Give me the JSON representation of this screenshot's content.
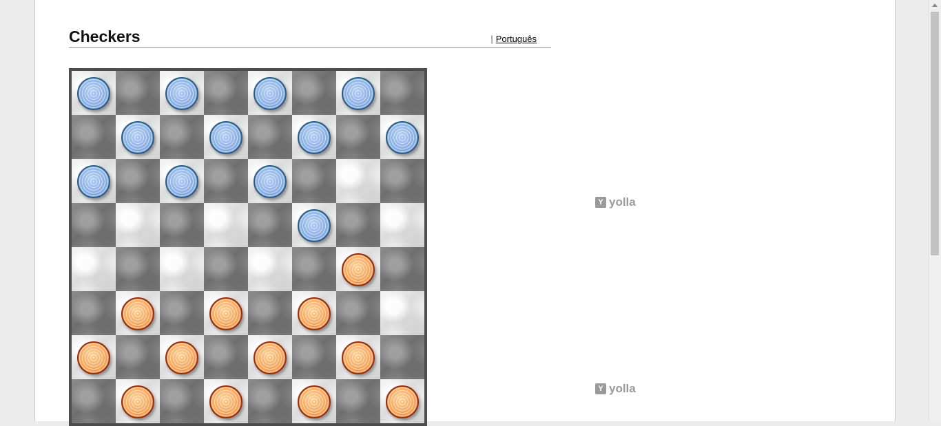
{
  "header": {
    "title": "Checkers",
    "lang_separator": "|",
    "lang_link": "Português"
  },
  "board": {
    "size": 8,
    "colors": {
      "light": "#e6e6e6",
      "dark": "#7a7a7a",
      "frame": "#4d4d4d"
    },
    "pieces": [
      {
        "row": 0,
        "col": 0,
        "color": "blue"
      },
      {
        "row": 0,
        "col": 2,
        "color": "blue"
      },
      {
        "row": 0,
        "col": 4,
        "color": "blue"
      },
      {
        "row": 0,
        "col": 6,
        "color": "blue"
      },
      {
        "row": 1,
        "col": 1,
        "color": "blue"
      },
      {
        "row": 1,
        "col": 3,
        "color": "blue"
      },
      {
        "row": 1,
        "col": 5,
        "color": "blue"
      },
      {
        "row": 1,
        "col": 7,
        "color": "blue"
      },
      {
        "row": 2,
        "col": 0,
        "color": "blue"
      },
      {
        "row": 2,
        "col": 2,
        "color": "blue"
      },
      {
        "row": 2,
        "col": 4,
        "color": "blue"
      },
      {
        "row": 3,
        "col": 5,
        "color": "blue"
      },
      {
        "row": 4,
        "col": 6,
        "color": "orange"
      },
      {
        "row": 5,
        "col": 1,
        "color": "orange"
      },
      {
        "row": 5,
        "col": 3,
        "color": "orange"
      },
      {
        "row": 5,
        "col": 5,
        "color": "orange"
      },
      {
        "row": 6,
        "col": 0,
        "color": "orange"
      },
      {
        "row": 6,
        "col": 2,
        "color": "orange"
      },
      {
        "row": 6,
        "col": 4,
        "color": "orange"
      },
      {
        "row": 6,
        "col": 6,
        "color": "orange"
      },
      {
        "row": 7,
        "col": 1,
        "color": "orange"
      },
      {
        "row": 7,
        "col": 3,
        "color": "orange"
      },
      {
        "row": 7,
        "col": 5,
        "color": "orange"
      },
      {
        "row": 7,
        "col": 7,
        "color": "orange"
      }
    ]
  },
  "ads": [
    {
      "label": "yolla",
      "icon": "yolla-logo-icon"
    },
    {
      "label": "yolla",
      "icon": "yolla-logo-icon"
    }
  ]
}
